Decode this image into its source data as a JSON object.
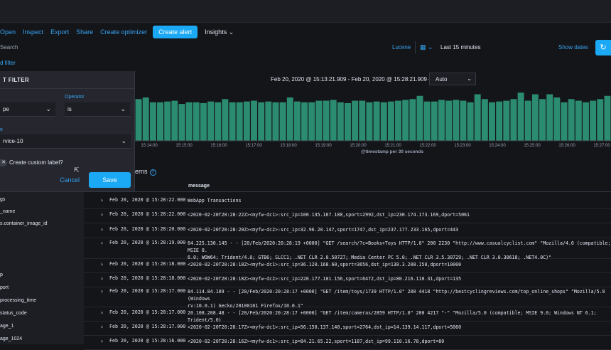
{
  "toolbar": {
    "links": [
      "Open",
      "Inspect",
      "Export",
      "Share",
      "Create optimizer"
    ],
    "create_alert": "Create alert",
    "insights": "Insights"
  },
  "query": {
    "placeholder": "Search",
    "lucene": "Lucene",
    "time_range": "Last 15 minutes",
    "show_dates": "Show dates"
  },
  "add_filter": "d filter",
  "filter_popover": {
    "title": "T FILTER",
    "operator_label": "Operator",
    "field_value": "pe",
    "operator_value": "is",
    "value_label": "e",
    "value_value": "rvice-10",
    "custom_label": "Create custom label?",
    "cancel": "Cancel",
    "save": "Save"
  },
  "histogram": {
    "range": "Feb 20, 2020 @ 15:13:21.909 - Feb 20, 2020 @ 15:28:21.909 —",
    "interval": "Auto",
    "xlabel": "@timestamp per 30 seconds",
    "patterns_label": "erns"
  },
  "chart_data": {
    "type": "bar",
    "xlabel": "@timestamp per 30 seconds",
    "tick_labels": [
      "15:14:00",
      "15:15:00",
      "15:16:00",
      "15:17:00",
      "15:18:00",
      "15:19:00",
      "15:20:00",
      "15:21:00",
      "15:22:00",
      "15:23:00",
      "15:24:00",
      "15:25:00",
      "15:26:00",
      "15:27:00"
    ],
    "values": [
      52,
      54,
      48,
      48,
      49,
      50,
      46,
      48,
      48,
      47,
      49,
      48,
      52,
      48,
      48,
      49,
      50,
      48,
      49,
      48,
      48,
      54,
      49,
      48,
      48,
      50,
      50,
      51,
      48,
      47,
      50,
      50,
      48,
      49,
      48,
      49,
      50,
      51,
      52,
      56,
      49,
      49,
      51,
      50,
      51,
      50,
      48,
      58,
      52,
      48,
      49,
      50,
      52,
      60,
      50,
      58,
      52,
      58,
      54,
      48,
      52,
      50,
      48,
      50,
      52,
      56
    ],
    "color": "#2b8c72"
  },
  "sidebar": {
    "fields": [
      "gs",
      "_name",
      "s.container_image_id",
      "p",
      "port",
      "processing_time",
      "status_code",
      "age_1",
      "age_1024"
    ]
  },
  "table": {
    "header": "message",
    "rows": [
      {
        "time": "Feb 20, 2020 @ 15:28:22.000",
        "message": "WebApp Transactions"
      },
      {
        "time": "Feb 20, 2020 @ 15:28:22.000",
        "message": "<2020-02-20T20:28:22Z><myfw-dc1>:src_ip=100.135.167.188,sport=2992,dst_ip=230.174.173.169,dport=5061"
      },
      {
        "time": "Feb 20, 2020 @ 15:28:20.000",
        "message": "<2020-02-20T20:28:20Z><myfw-dc2>:src_ip=32.96.20.147,sport=1747,dst_ip=237.177.233.165,dport=443"
      },
      {
        "time": "Feb 20, 2020 @ 15:28:19.000",
        "message": "64.225.130.145 - - [20/Feb/2020:20:28:19 +0000] \"GET /search/?c=Books+Toys HTTP/1.0\" 200 2230 \"http://www.casualcyclist.com\" \"Mozilla/4.0 (compatible; MSIE 8.\n6.0; WOW64; Trident/4.0; GTB6; SLCC1; .NET CLR 2.0.50727; Media Center PC 5.0; .NET CLR 3.5.30729; .NET CLR 3.0.30618; .NET4.0C)\""
      },
      {
        "time": "Feb 20, 2020 @ 15:28:18.000",
        "message": "<2020-02-20T20:28:18Z><myfw-dc1>:src_ip=36.120.168.60,sport=3656,dst_ip=138.3.208.150,dport=10000"
      },
      {
        "time": "Feb 20, 2020 @ 15:28:18.000",
        "message": "<2020-02-20T20:28:18Z><myfw-dc2>:src_ip=220.177.101.156,sport=6472,dst_ip=80.216.110.31,dport=135"
      },
      {
        "time": "Feb 20, 2020 @ 15:28:17.000",
        "message": "84.114.84.109 - - [20/Feb/2020:20:28:17 +0000] \"GET /item/toys/1739 HTTP/1.0\" 200 4418 \"http://bestcyclingreviews.com/top_online_shops\" \"Mozilla/5.0 (Windows\nrv:10.0.1) Gecko/20100101 Firefox/10.0.1\""
      },
      {
        "time": "Feb 20, 2020 @ 15:28:17.000",
        "message": "20.108.208.48 - - [20/Feb/2020:20:28:17 +0000] \"GET /item/cameras/2859 HTTP/1.0\" 200 4217 \"-\" \"Mozilla/5.0 (compatible; MSIE 9.0; Windows NT 6.1; Trident/5.0)"
      },
      {
        "time": "Feb 20, 2020 @ 15:28:17.000",
        "message": "<2020-02-20T20:28:17Z><myfw-dc1>:src_ip=56.150.137.140,sport=2764,dst_ip=14.139.14.117,dport=5060"
      },
      {
        "time": "Feb 20, 2020 @ 15:28:16.000",
        "message": "<2020-02-20T20:28:16Z><myfw-dc1>:src_ip=84.21.65.22,sport=1187,dst_ip=99.110.16.78,dport=80"
      }
    ]
  }
}
